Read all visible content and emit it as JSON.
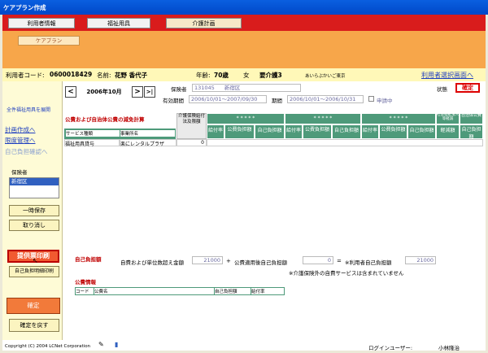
{
  "window": {
    "title": "ケアプラン作成"
  },
  "tabs": [
    {
      "label": "利用者情報"
    },
    {
      "label": "福祉用具"
    },
    {
      "label": "介護計画"
    }
  ],
  "subtab": {
    "label": "ケアプラン"
  },
  "user": {
    "code_label": "利用者コード:",
    "code": "0600018429",
    "name_label": "名前:",
    "name": "花野 香代子",
    "age_label": "年齢:",
    "age": "70歳",
    "sex": "女",
    "care_level": "要介護3",
    "office": "あいらぶかいご東京",
    "select_link": "利用者選択画面へ"
  },
  "period": {
    "prev": "<",
    "month": "2006年10月",
    "next": ">",
    "last": ">|",
    "insurer_label": "保険者",
    "insurer_code": "131045",
    "insurer_name": "新宿区",
    "valid_label": "有効期間",
    "valid_value": "2006/10/01〜2007/09/30",
    "term_label": "期間",
    "term_value": "2006/10/01〜2006/10/31",
    "applying_label": "申請中",
    "status_label": "状態",
    "status_value": "確定"
  },
  "left": {
    "info": "全件福祉用具を展開",
    "links": [
      "計画作成へ",
      "限度管理へ",
      "自己負担確認へ"
    ],
    "insurer_label": "保険者",
    "insurer_item": "新宿区",
    "save_button": "一時保存",
    "cancel_button": "取り消し",
    "print_button": "提供票印刷",
    "detail_print_button": "自己負担明細印刷",
    "confirm_button": "確定",
    "revert_button": "確定を戻す"
  },
  "table": {
    "title": "公費および自治体公費の減免計算",
    "col_service_type": "サービス種類",
    "col_office": "事業所名",
    "col_over": "介護保険給付法及限額",
    "group_stars": "* * * * *",
    "sub_headers": [
      "給付率",
      "公費負担額",
      "自己負担額"
    ],
    "col_social": "社会福祉法人等軽減",
    "col_reduction": "軽減額",
    "col_local": "自治体公費",
    "col_self": "自己負担額",
    "rows": [
      {
        "service": "福祉用具貸与",
        "office": "楽にレンタルプラザ",
        "over": "0"
      }
    ]
  },
  "summary": {
    "label": "自己負担額",
    "over_label": "自費および単位数超え金額",
    "over_value": "21000",
    "plus": "+",
    "public_label": "公費適用後自己負担額",
    "public_value": "0",
    "equals": "=",
    "total_label": "※利用者自己負担額",
    "total_value": "21000",
    "note": "※介護保険外の自費サービスは含まれていません"
  },
  "public_info": {
    "label": "公費情報",
    "headers": [
      "コード",
      "公費名",
      "自己負担額",
      "給付率"
    ]
  },
  "footer": {
    "copyright": "Copyright (C) 2004 LCNet Corporation",
    "login_label": "ログインユーザー:",
    "login_user": "小林隆治"
  }
}
